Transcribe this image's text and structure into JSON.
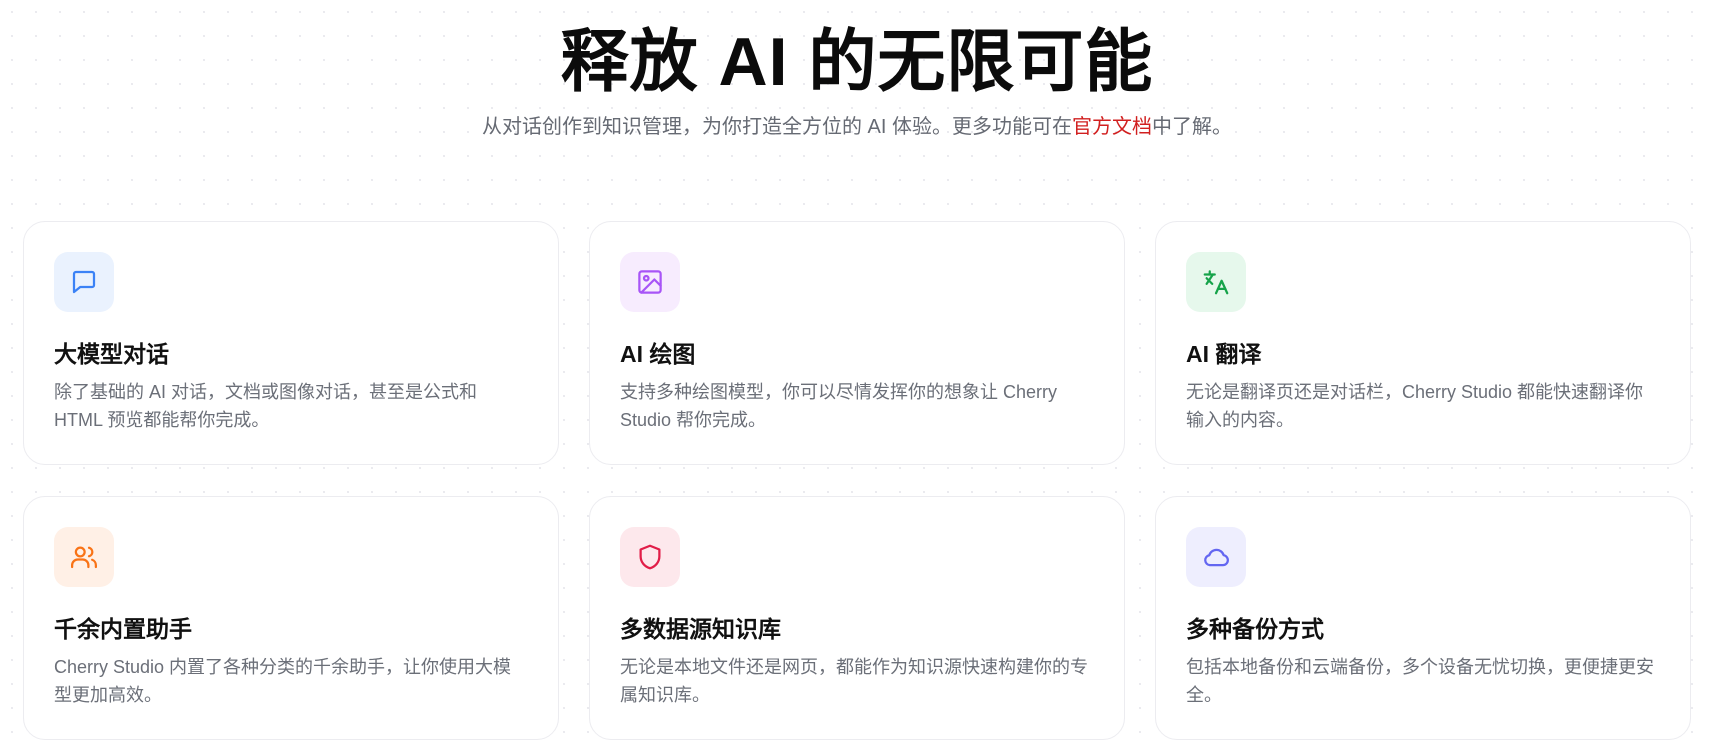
{
  "hero": {
    "title": "释放 AI 的无限可能",
    "subtitle_before": "从对话创作到知识管理，为你打造全方位的 AI 体验。更多功能可在",
    "subtitle_link": "官方文档",
    "subtitle_after": "中了解。"
  },
  "colors": {
    "link": "#d11f1f",
    "chat": "#3b82f6",
    "drawing": "#a855f7",
    "translate": "#16a34a",
    "assistants": "#f97316",
    "knowledge": "#e11d48",
    "backup": "#6366f1"
  },
  "features": [
    {
      "icon": "chat-bubble-icon",
      "title": "大模型对话",
      "description": "除了基础的 AI 对话，文档或图像对话，甚至是公式和 HTML 预览都能帮你完成。"
    },
    {
      "icon": "image-icon",
      "title": "AI 绘图",
      "description": "支持多种绘图模型，你可以尽情发挥你的想象让 Cherry Studio 帮你完成。"
    },
    {
      "icon": "translate-icon",
      "title": "AI 翻译",
      "description": "无论是翻译页还是对话栏，Cherry Studio 都能快速翻译你输入的内容。"
    },
    {
      "icon": "users-icon",
      "title": "千余内置助手",
      "description": "Cherry Studio 内置了各种分类的千余助手，让你使用大模型更加高效。"
    },
    {
      "icon": "shield-icon",
      "title": "多数据源知识库",
      "description": "无论是本地文件还是网页，都能作为知识源快速构建你的专属知识库。"
    },
    {
      "icon": "cloud-icon",
      "title": "多种备份方式",
      "description": "包括本地备份和云端备份，多个设备无忧切换，更便捷更安全。"
    }
  ]
}
